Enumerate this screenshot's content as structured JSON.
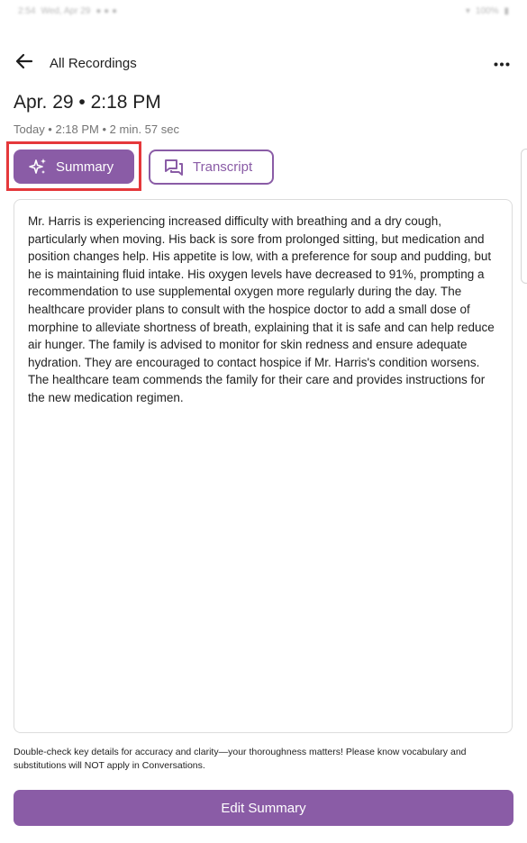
{
  "status_bar": {
    "time": "2:54",
    "date": "Wed, Apr 29",
    "battery": "100%"
  },
  "header": {
    "back_icon": "arrow-left-icon",
    "title": "All Recordings",
    "more_icon": "more-horizontal-icon"
  },
  "recording": {
    "title": "Apr. 29 • 2:18 PM",
    "meta": "Today • 2:18 PM • 2 min. 57 sec"
  },
  "tabs": {
    "summary": {
      "label": "Summary",
      "icon": "sparkle-icon",
      "selected": true
    },
    "transcript": {
      "label": "Transcript",
      "icon": "chat-bubbles-icon",
      "selected": false
    }
  },
  "summary_text": "Mr. Harris is experiencing increased difficulty with breathing and a dry cough, particularly when moving. His back is sore from prolonged sitting, but medication and position changes help. His appetite is low, with a preference for soup and pudding, but he is maintaining fluid intake. His oxygen levels have decreased to 91%, prompting a recommendation to use supplemental oxygen more regularly during the day. The healthcare provider plans to consult with the hospice doctor to add a small dose of morphine to alleviate shortness of breath, explaining that it is safe and can help reduce air hunger. The family is advised to monitor for skin redness and ensure adequate hydration. They are encouraged to contact hospice if Mr. Harris's condition worsens. The healthcare team commends the family for their care and provides instructions for the new medication regimen.",
  "disclaimer": "Double-check key details for accuracy and clarity—your thoroughness matters! Please know vocabulary and substitutions will NOT apply in Conversations.",
  "edit_button_label": "Edit Summary",
  "colors": {
    "accent": "#8a5ca6",
    "highlight": "#e5383b"
  }
}
